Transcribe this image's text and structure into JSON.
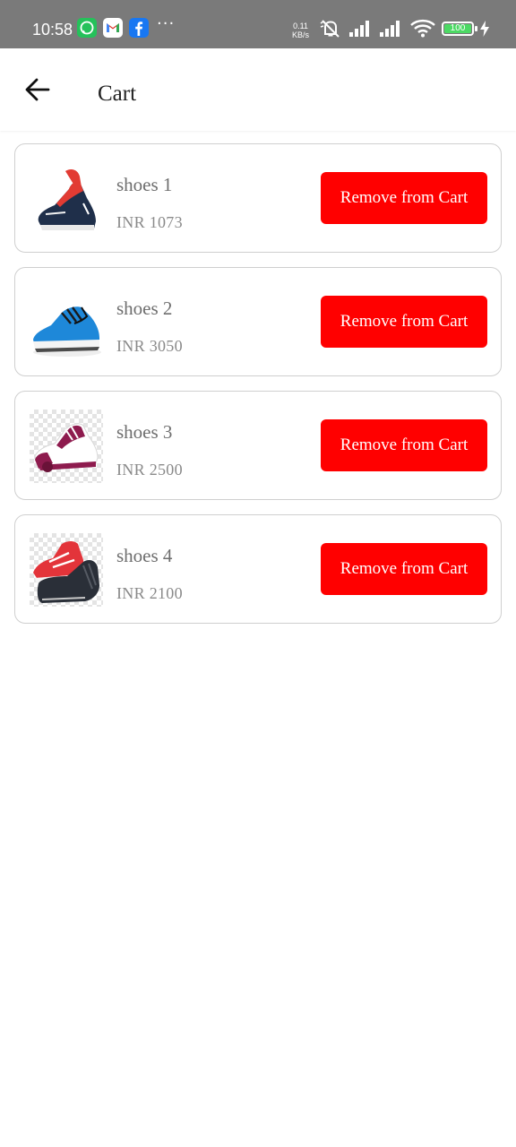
{
  "status_bar": {
    "time": "10:58",
    "notification_icons": [
      "whatsapp-icon",
      "gmail-icon",
      "facebook-icon"
    ],
    "more_indicator": "···",
    "net_speed_value": "0.11",
    "net_speed_unit": "KB/s",
    "battery_level": "100",
    "colors": {
      "background": "#7a7a7a",
      "battery": "#4cd964"
    }
  },
  "app_bar": {
    "back_icon": "arrow-left-icon",
    "title": "Cart"
  },
  "colors": {
    "accent": "#ff0000",
    "card_border": "#cfcfcf",
    "name_text": "#6e6e6e",
    "price_text": "#8a8a8a"
  },
  "cart": {
    "items": [
      {
        "name": "shoes 1",
        "price": "INR 1073",
        "button_label": "Remove from Cart"
      },
      {
        "name": "shoes 2",
        "price": "INR 3050",
        "button_label": "Remove from Cart"
      },
      {
        "name": "shoes 3",
        "price": "INR 2500",
        "button_label": "Remove from Cart"
      },
      {
        "name": "shoes 4",
        "price": "INR 2100",
        "button_label": "Remove from Cart"
      }
    ]
  }
}
